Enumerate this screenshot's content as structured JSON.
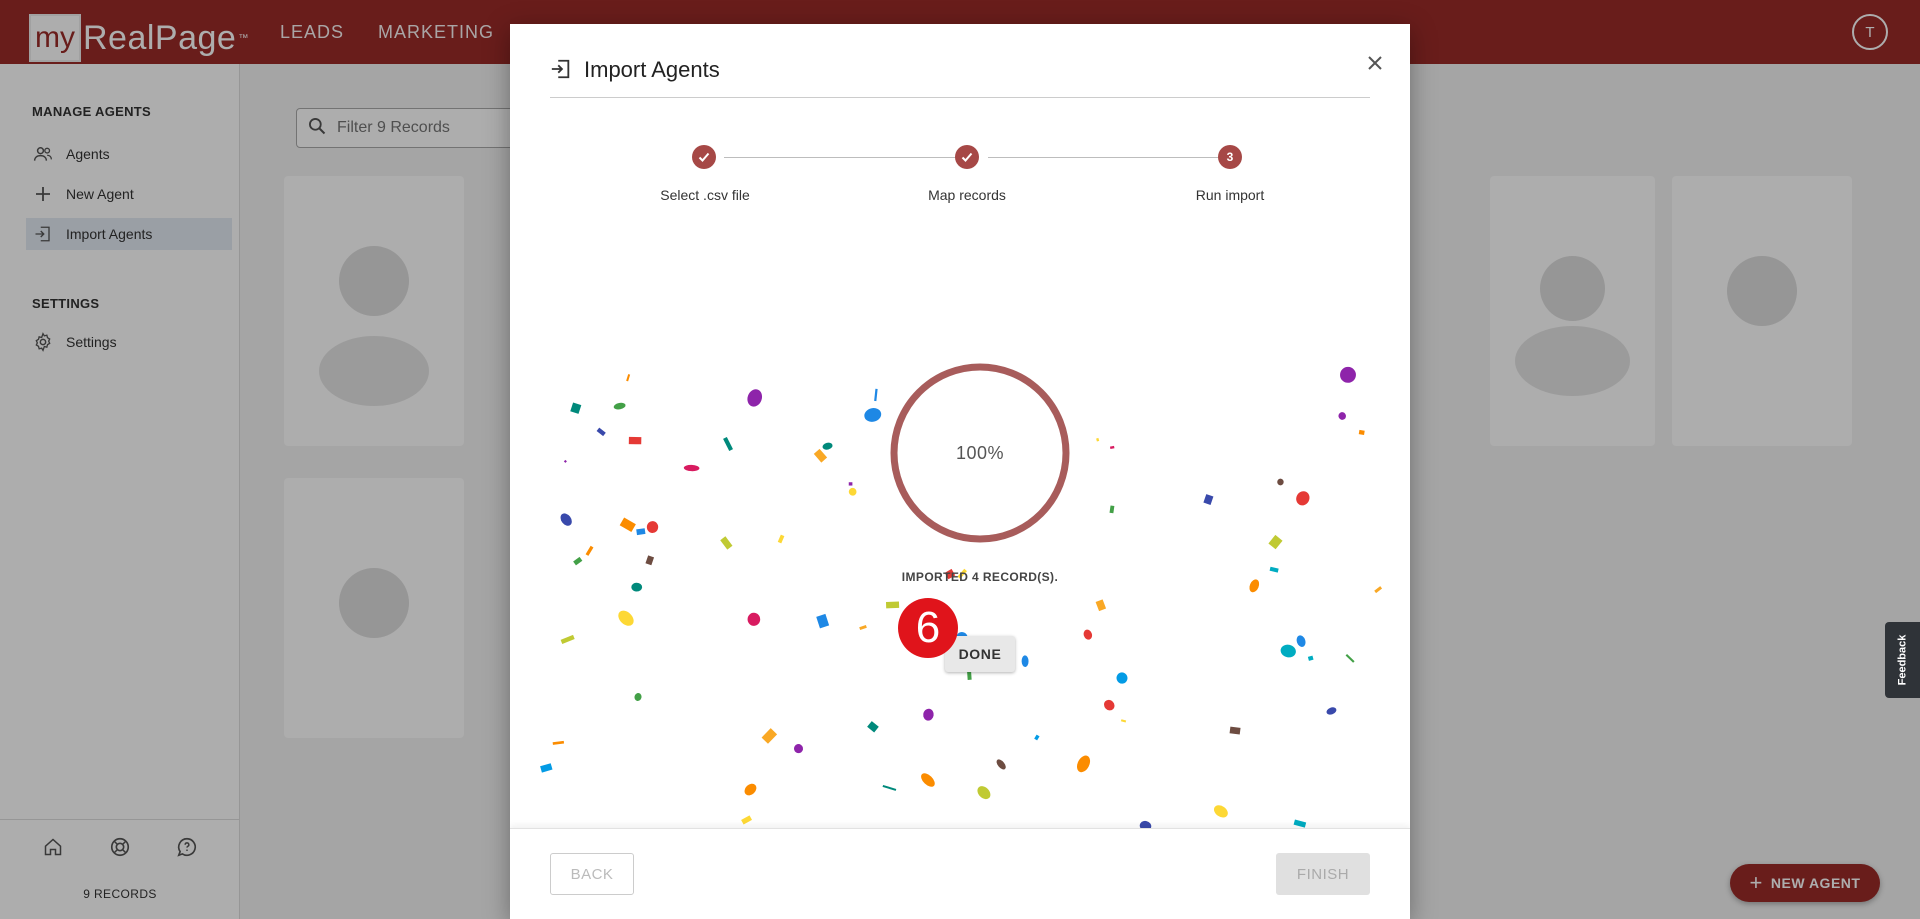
{
  "app": {
    "logo_first": "my",
    "logo_rest": "RealPage",
    "logo_tm": "™",
    "nav": [
      "LEADS",
      "MARKETING"
    ],
    "user_initial": "T"
  },
  "sidebar": {
    "section1": "MANAGE AGENTS",
    "items": [
      {
        "label": "Agents",
        "icon": "people-icon"
      },
      {
        "label": "New Agent",
        "icon": "plus-icon"
      },
      {
        "label": "Import Agents",
        "icon": "import-icon",
        "active": true
      }
    ],
    "section2": "SETTINGS",
    "settings_item": {
      "label": "Settings",
      "icon": "gear-icon"
    },
    "bottom_icons": [
      "home-icon",
      "help-icon",
      "chat-icon"
    ],
    "record_count": "9 RECORDS"
  },
  "filter": {
    "placeholder": "Filter 9 Records"
  },
  "fab_label": "NEW AGENT",
  "feedback_label": "Feedback",
  "modal": {
    "title": "Import Agents",
    "steps": [
      {
        "label": "Select .csv file",
        "state": "done"
      },
      {
        "label": "Map records",
        "state": "done"
      },
      {
        "label": "Run import",
        "state": "active",
        "number": "3"
      }
    ],
    "progress": {
      "value": 100,
      "text": "100%"
    },
    "imported_text": "IMPORTED 4 RECORD(S).",
    "done_label": "DONE",
    "back_label": "BACK",
    "finish_label": "FINISH",
    "accent": "#a64846"
  },
  "annotation_badge": "6"
}
